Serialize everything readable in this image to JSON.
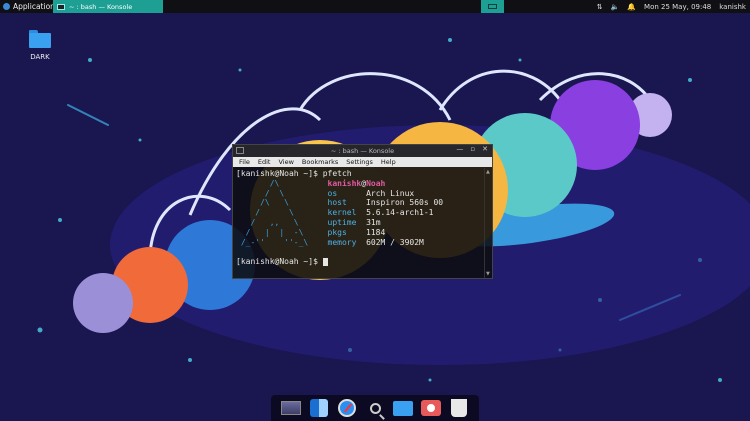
{
  "panel": {
    "apps_label": "Applications",
    "task_title": "~ : bash — Konsole",
    "user": "kanishk",
    "clock": "Mon 25 May, 09:48"
  },
  "desktop_icon": {
    "label": "DARK"
  },
  "konsole": {
    "title": "~ : bash — Konsole",
    "menu": [
      "File",
      "Edit",
      "View",
      "Bookmarks",
      "Settings",
      "Help"
    ],
    "prompt": "[kanishk@Noah ~]$",
    "command": "pfetch",
    "user": "kanishk",
    "host": "Noah",
    "info": [
      {
        "k": "os",
        "v": "Arch Linux"
      },
      {
        "k": "host",
        "v": "Inspiron 560s 00"
      },
      {
        "k": "kernel",
        "v": "5.6.14-arch1-1"
      },
      {
        "k": "uptime",
        "v": "31m"
      },
      {
        "k": "pkgs",
        "v": "1184"
      },
      {
        "k": "memory",
        "v": "602M / 3902M"
      }
    ]
  },
  "dock": {
    "items": [
      "terminal-icon",
      "finder-icon",
      "safari-icon",
      "search-icon",
      "folder-icon",
      "camera-icon",
      "trash-icon"
    ]
  },
  "colors": {
    "panel_accent": "#1d9f94",
    "background": "#1a1650",
    "prompt_pink": "#e05a9e",
    "label_blue": "#4db0e6"
  }
}
